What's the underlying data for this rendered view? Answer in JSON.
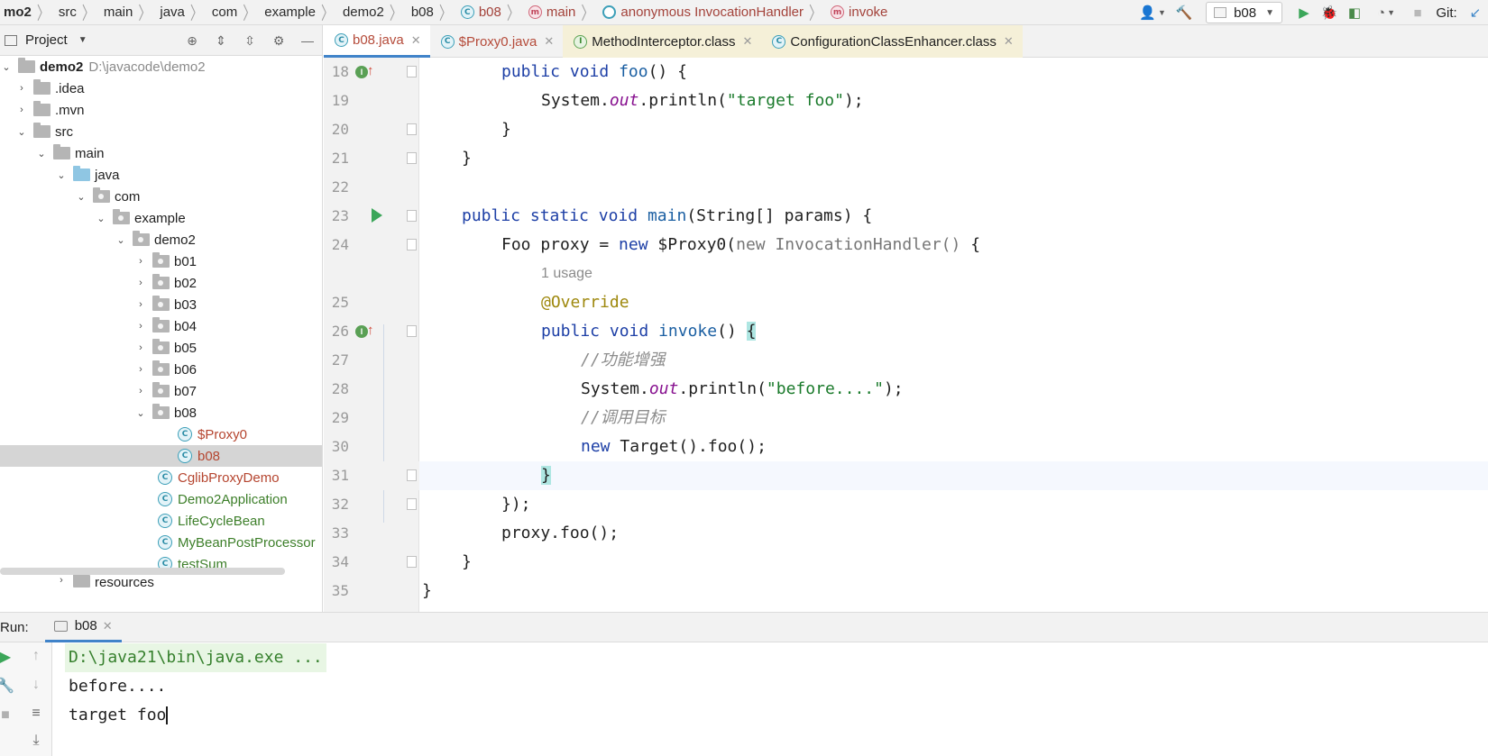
{
  "breadcrumbs": [
    {
      "label": "mo2",
      "kind": "project",
      "icon": ""
    },
    {
      "label": "src",
      "kind": "folder",
      "icon": ""
    },
    {
      "label": "main",
      "kind": "folder",
      "icon": ""
    },
    {
      "label": "java",
      "kind": "folder",
      "icon": ""
    },
    {
      "label": "com",
      "kind": "folder",
      "icon": ""
    },
    {
      "label": "example",
      "kind": "folder",
      "icon": ""
    },
    {
      "label": "demo2",
      "kind": "folder",
      "icon": ""
    },
    {
      "label": "b08",
      "kind": "folder",
      "icon": ""
    },
    {
      "label": "b08",
      "kind": "class",
      "icon": "C"
    },
    {
      "label": "main",
      "kind": "method",
      "icon": "m"
    },
    {
      "label": "anonymous InvocationHandler",
      "kind": "anonymous",
      "icon": "C"
    },
    {
      "label": "invoke",
      "kind": "method",
      "icon": "m"
    }
  ],
  "toolbar": {
    "run_config": "b08",
    "git_label": "Git:"
  },
  "project_panel": {
    "title": "Project"
  },
  "tree": {
    "root_name": "demo2",
    "root_path": "D:\\javacode\\demo2",
    "idea": ".idea",
    "mvn": ".mvn",
    "src": "src",
    "main": "main",
    "java": "java",
    "com": "com",
    "example": "example",
    "demo2": "demo2",
    "packages": [
      "b01",
      "b02",
      "b03",
      "b04",
      "b05",
      "b06",
      "b07"
    ],
    "b08": "b08",
    "b08_children": [
      "$Proxy0",
      "b08"
    ],
    "classes": [
      "CglibProxyDemo",
      "Demo2Application",
      "LifeCycleBean",
      "MyBeanPostProcessor",
      "testSum"
    ],
    "resources": "resources"
  },
  "editor_tabs": [
    {
      "label": "b08.java",
      "icon": "C",
      "active": true
    },
    {
      "label": "$Proxy0.java",
      "icon": "C",
      "active": false
    },
    {
      "label": "MethodInterceptor.class",
      "icon": "I",
      "active": false
    },
    {
      "label": "ConfigurationClassEnhancer.class",
      "icon": "C",
      "active": false
    }
  ],
  "code": {
    "line_numbers": [
      "18",
      "19",
      "20",
      "21",
      "22",
      "23",
      "24",
      "",
      "25",
      "26",
      "27",
      "28",
      "29",
      "30",
      "31",
      "32",
      "33",
      "34",
      "35"
    ],
    "l18": {
      "kw1": "public",
      "kw2": "void",
      "fn": "foo",
      "rest": "() {"
    },
    "l19": {
      "pre": "System.",
      "field": "out",
      "mid": ".println(",
      "str": "\"target foo\"",
      "end": ");"
    },
    "l20": "}",
    "l21": "}",
    "l23": {
      "kw1": "public",
      "kw2": "static",
      "kw3": "void",
      "fn": "main",
      "rest": "(String[] params) {"
    },
    "l24": {
      "pre": "Foo proxy = ",
      "kw": "new",
      "mid": " $Proxy0(",
      "dim": "new InvocationHandler()",
      "end": " {"
    },
    "usage_hint": "1 usage",
    "l25": "@Override",
    "l26": {
      "kw1": "public",
      "kw2": "void",
      "fn": "invoke",
      "rest": "() ",
      "brace": "{"
    },
    "l27": "//功能增强",
    "l28": {
      "pre": "System.",
      "field": "out",
      "mid": ".println(",
      "str": "\"before....\"",
      "end": ");"
    },
    "l29": "//调用目标",
    "l30": {
      "kw": "new",
      "rest": " Target().foo();"
    },
    "l31": "}",
    "l32": "});",
    "l33": "proxy.foo();",
    "l34": "}",
    "l35": "}"
  },
  "run_panel": {
    "label": "Run:",
    "tab": "b08",
    "lines": [
      "D:\\java21\\bin\\java.exe ...",
      "before....",
      "target foo"
    ]
  }
}
